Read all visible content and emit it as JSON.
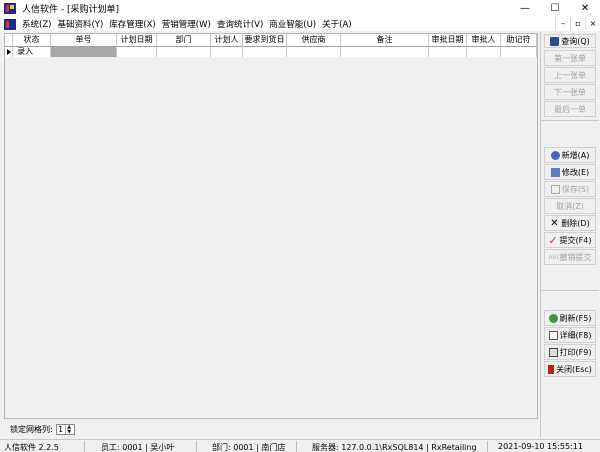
{
  "window": {
    "title": "人信软件 - [采购计划单]",
    "controls": [
      "—",
      "☐",
      "✕"
    ]
  },
  "menu": {
    "items": [
      "系统(Z)",
      "基础资料(Y)",
      "库存管理(X)",
      "营销管理(W)",
      "查询统计(V)",
      "商业智能(U)",
      "关于(A)"
    ],
    "right_controls": [
      "–",
      "▫",
      "×"
    ]
  },
  "grid": {
    "columns": [
      "状态",
      "单号",
      "计划日期",
      "部门",
      "计划人",
      "要求到货日",
      "供应商",
      "备注",
      "审批日期",
      "审批人",
      "助记符"
    ],
    "rows": [
      {
        "status": "录入",
        "number": "",
        "date": "",
        "dept": "",
        "planner": "",
        "due": "",
        "supplier": "",
        "note": "",
        "approve_date": "",
        "approver": "",
        "mnemonic": ""
      }
    ]
  },
  "lock_columns": {
    "label": "锁定网格列:",
    "value": "1"
  },
  "sidebar": {
    "query": "查询(Q)",
    "first": "第一张单",
    "prev": "上一张单",
    "next": "下一张单",
    "last": "最后一单",
    "add": "新增(A)",
    "edit": "修改(E)",
    "save": "保存(S)",
    "cancel": "取消(Z)",
    "delete": "删除(D)",
    "submit": "提交(F4)",
    "revoke": "撤销提交",
    "refresh": "刷新(F5)",
    "detail": "详细(F8)",
    "print": "打印(F9)",
    "close": "关闭(Esc)"
  },
  "statusbar": {
    "app": "人信软件 2.2.5",
    "employee": "员工: 0001 | 吴小叶",
    "department": "部门: 0001 | 南门店",
    "server": "服务器: 127.0.0.1\\RxSQL814 | RxRetailing",
    "datetime": "2021-09-10 15:55:11"
  },
  "colors": {
    "accent": "#1c2a8a",
    "selected_cell": "#a8a8a8",
    "submit_check": "#c0392b"
  }
}
